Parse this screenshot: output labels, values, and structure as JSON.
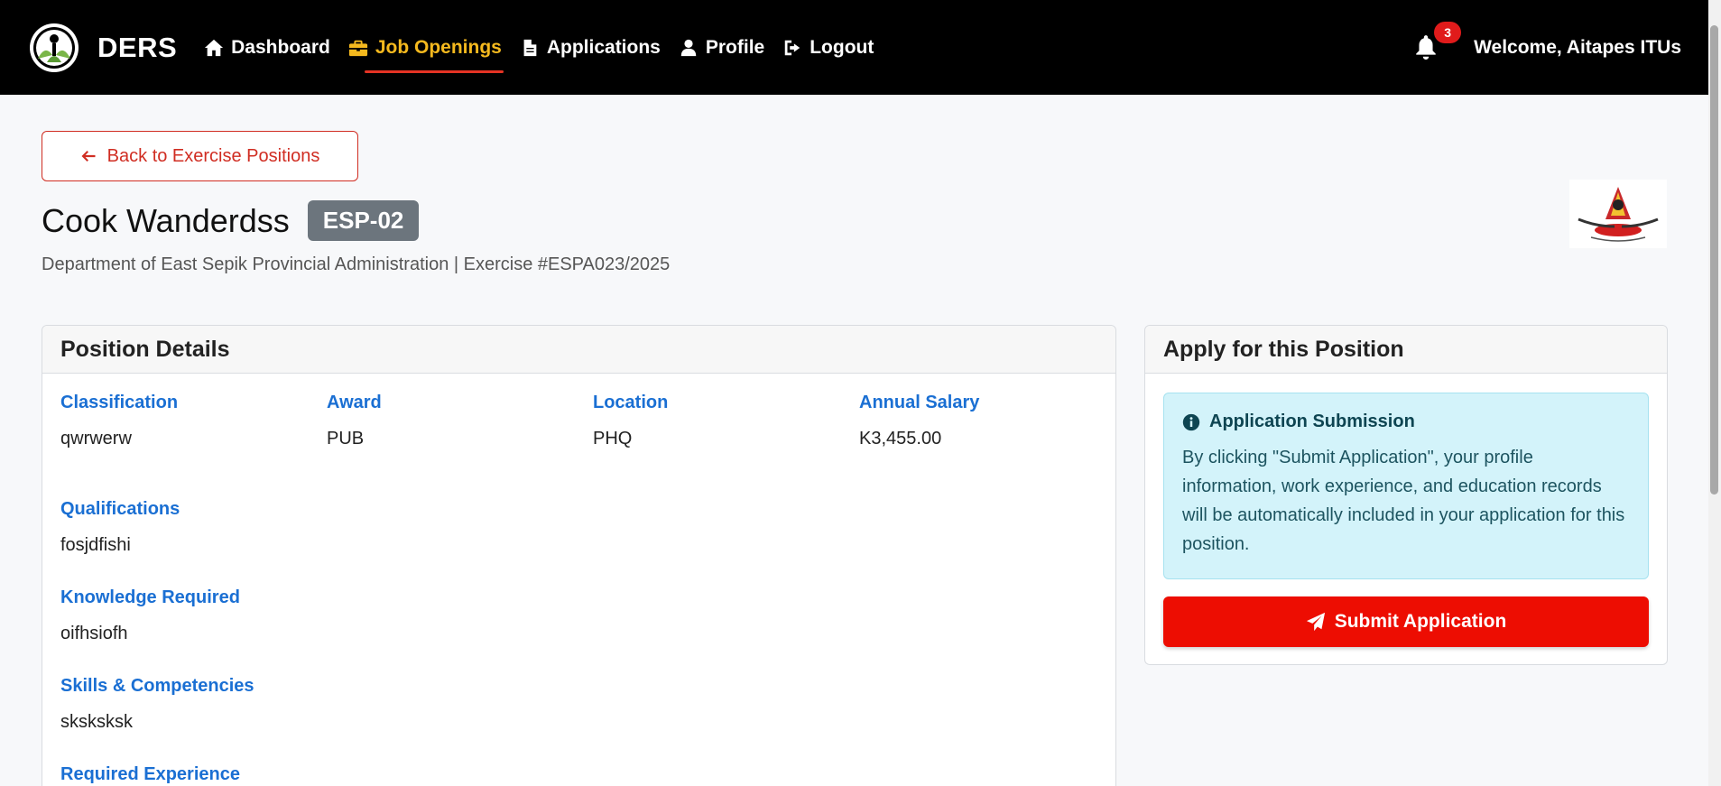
{
  "navbar": {
    "brand": "DERS",
    "items": [
      {
        "label": "Dashboard",
        "icon": "home-icon"
      },
      {
        "label": "Job Openings",
        "icon": "briefcase-icon"
      },
      {
        "label": "Applications",
        "icon": "document-icon"
      },
      {
        "label": "Profile",
        "icon": "user-icon"
      },
      {
        "label": "Logout",
        "icon": "logout-icon"
      }
    ],
    "active_item": "Job Openings",
    "notification_count": "3",
    "welcome": "Welcome, Aitapes ITUs"
  },
  "back_button": "Back to Exercise Positions",
  "position": {
    "title": "Cook Wanderdss",
    "code": "ESP-02",
    "subtitle": "Department of East Sepik Provincial Administration | Exercise #ESPA023/2025"
  },
  "details": {
    "header": "Position Details",
    "fields": [
      {
        "label": "Classification",
        "value": "qwrwerw"
      },
      {
        "label": "Award",
        "value": "PUB"
      },
      {
        "label": "Location",
        "value": "PHQ"
      },
      {
        "label": "Annual Salary",
        "value": "K3,455.00"
      },
      {
        "label": "Qualifications",
        "value": "fosjdfishi"
      },
      {
        "label": "Knowledge Required",
        "value": "oifhsiofh"
      },
      {
        "label": "Skills & Competencies",
        "value": "sksksksk"
      },
      {
        "label": "Required Experience",
        "value": ""
      }
    ]
  },
  "apply": {
    "header": "Apply for this Position",
    "info_title": "Application Submission",
    "info_text": "By clicking \"Submit Application\", your profile information, work experience, and education records will be automatically included in your application for this position.",
    "submit_label": "Submit Application"
  },
  "colors": {
    "navbar_bg": "#000000",
    "active_nav": "#f5b91e",
    "label_blue": "#1a6fd3",
    "submit_red": "#ed0d02",
    "info_bg": "#d3f3fa"
  }
}
